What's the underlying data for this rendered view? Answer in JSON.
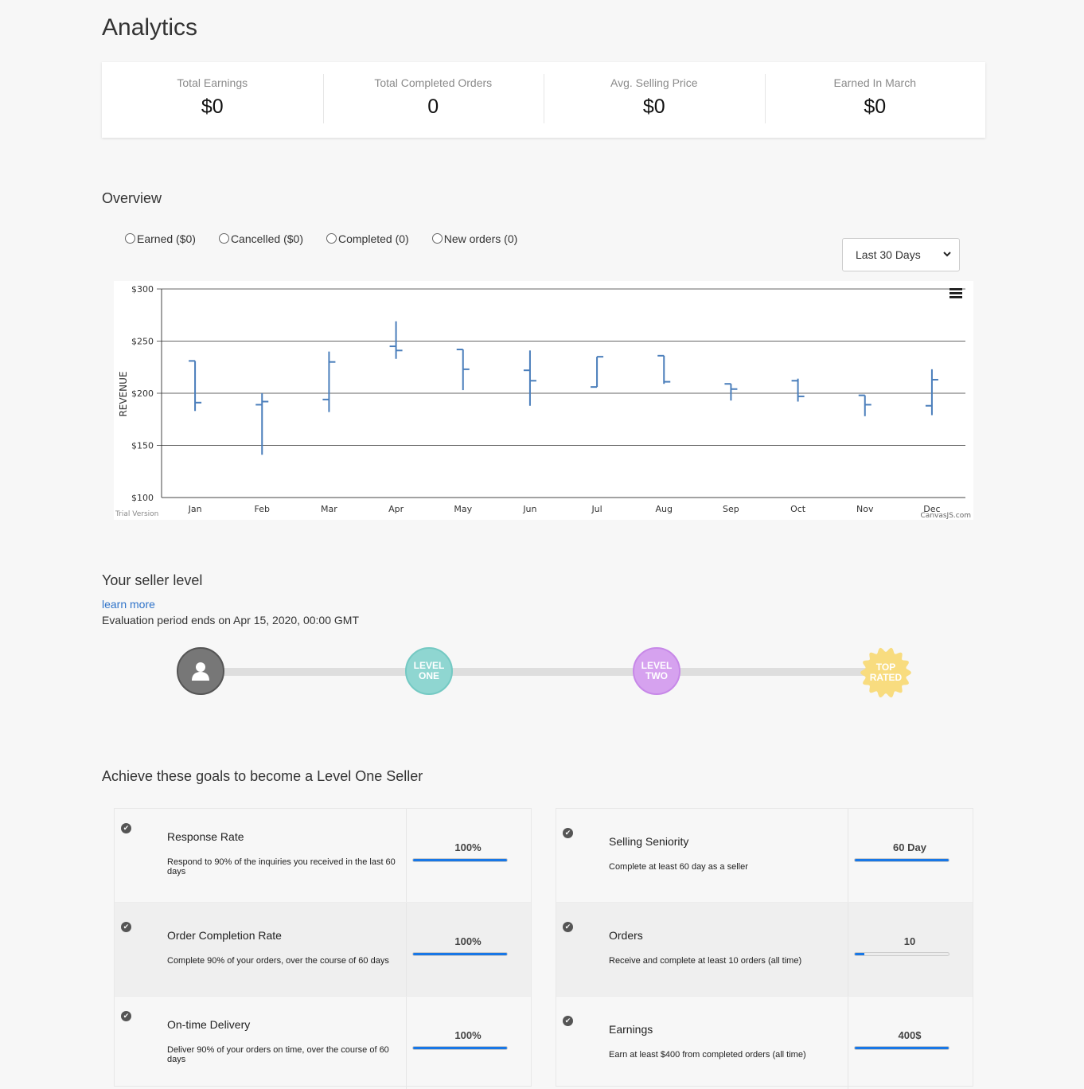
{
  "page": {
    "title": "Analytics"
  },
  "stats": [
    {
      "label": "Total Earnings",
      "value": "$0"
    },
    {
      "label": "Total Completed Orders",
      "value": "0"
    },
    {
      "label": "Avg. Selling Price",
      "value": "$0"
    },
    {
      "label": "Earned In March",
      "value": "$0"
    }
  ],
  "overview": {
    "title": "Overview",
    "filters": [
      {
        "label": "Earned ($0)",
        "checked": false
      },
      {
        "label": "Cancelled ($0)",
        "checked": false
      },
      {
        "label": "Completed (0)",
        "checked": false
      },
      {
        "label": "New orders (0)",
        "checked": false
      }
    ],
    "range_select": "Last 30 Days",
    "trial_text": "Trial Version",
    "credit_text": "CanvasJS.com"
  },
  "chart_data": {
    "type": "ohlc",
    "ylabel": "REVENUE",
    "xlabel": "",
    "y_ticks": [
      "$100",
      "$150",
      "$200",
      "$250",
      "$300"
    ],
    "ylim": [
      100,
      300
    ],
    "grid": true,
    "categories": [
      "Jan",
      "Feb",
      "Mar",
      "Apr",
      "May",
      "Jun",
      "Jul",
      "Aug",
      "Sep",
      "Oct",
      "Nov",
      "Dec"
    ],
    "ohlc": [
      {
        "open": 231,
        "high": 231,
        "low": 183,
        "close": 191
      },
      {
        "open": 189,
        "high": 200,
        "low": 141,
        "close": 192
      },
      {
        "open": 194,
        "high": 240,
        "low": 182,
        "close": 230
      },
      {
        "open": 245,
        "high": 269,
        "low": 233,
        "close": 241
      },
      {
        "open": 242,
        "high": 242,
        "low": 203,
        "close": 223
      },
      {
        "open": 222,
        "high": 241,
        "low": 188,
        "close": 212
      },
      {
        "open": 206,
        "high": 235,
        "low": 206,
        "close": 235
      },
      {
        "open": 236,
        "high": 236,
        "low": 209,
        "close": 211
      },
      {
        "open": 209,
        "high": 209,
        "low": 193,
        "close": 204
      },
      {
        "open": 212,
        "high": 214,
        "low": 192,
        "close": 197
      },
      {
        "open": 198,
        "high": 198,
        "low": 178,
        "close": 189
      },
      {
        "open": 188,
        "high": 223,
        "low": 179,
        "close": 213
      }
    ]
  },
  "seller_level": {
    "title": "Your seller level",
    "learn_more": "learn more",
    "evaluation": "Evaluation period ends on Apr 15, 2020, 00:00 GMT",
    "levels": [
      {
        "line1": "LEVEL",
        "line2": "ONE",
        "color": "#8fd6d1"
      },
      {
        "line1": "LEVEL",
        "line2": "TWO",
        "color": "#d6a2ef"
      },
      {
        "line1": "TOP",
        "line2": "RATED",
        "color": "#f8dc7f"
      }
    ]
  },
  "goals": {
    "title": "Achieve these goals to become a Level One Seller",
    "left": [
      {
        "title": "Response Rate",
        "desc": "Respond to 90% of the inquiries you received in the last 60 days",
        "value": "100%",
        "progress": 1.0
      },
      {
        "title": "Order Completion Rate",
        "desc": "Complete 90% of your orders, over the course of 60 days",
        "value": "100%",
        "progress": 1.0
      },
      {
        "title": "On-time Delivery",
        "desc": "Deliver 90% of your orders on time, over the course of 60 days",
        "value": "100%",
        "progress": 1.0
      }
    ],
    "right": [
      {
        "title": "Selling Seniority",
        "desc": "Complete at least 60 day as a seller",
        "value": "60 Day",
        "progress": 1.0
      },
      {
        "title": "Orders",
        "desc": "Receive and complete at least 10 orders (all time)",
        "value": "10",
        "progress": 0.1
      },
      {
        "title": "Earnings",
        "desc": "Earn at least $400 from completed orders (all time)",
        "value": "400$",
        "progress": 1.0
      }
    ]
  }
}
